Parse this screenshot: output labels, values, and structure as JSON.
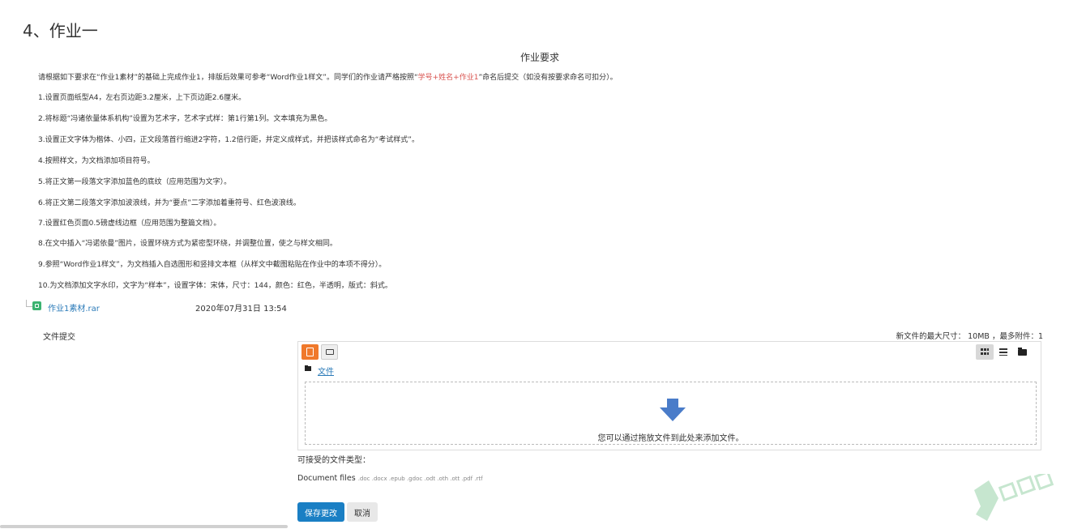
{
  "page": {
    "title": "4、作业一",
    "requirements_heading": "作业要求"
  },
  "requirements": {
    "intro_pre": "请根据如下要求在“作业1素材”的基础上完成作业1，排版后效果可参考“Word作业1样文”。同学们的作业请严格按照“",
    "intro_highlight": "学号+姓名+作业1",
    "intro_post": "”命名后提交（如没有按要求命名可扣分）。",
    "items": [
      "1.设置页面纸型A4，左右页边距3.2厘米，上下页边距2.6厘米。",
      "2.将标题“冯诸依量体系机构”设置为艺术字，艺术字式样：第1行第1列。文本填充为黑色。",
      "3.设置正文字体为楷体、小四，正文段落首行缩进2字符，1.2倍行距，并定义成样式，并把该样式命名为“考试样式”。",
      "4.按照样文，为文档添加项目符号。",
      "5.将正文第一段落文字添加蓝色的底纹（应用范围为文字）。",
      "6.将正文第二段落文字添加波浪线，并为“要点”二字添加着重符号、红色波浪线。",
      "7.设置红色页面0.5磅虚线边框（应用范围为整篇文档）。",
      "8.在文中插入“冯诺依曼”图片，设置环绕方式为紧密型环绕，并调整位置，使之与样文相同。",
      "9.参照“Word作业1样文”，为文档插入自选图形和竖排文本框（从样文中截图粘贴在作业中的本项不得分）。",
      "10.为文档添加文字水印，文字为“样本”，设置字体：宋体，尺寸：144，颜色：红色，半透明，版式：斜式。"
    ]
  },
  "attachment": {
    "name": "作业1素材.rar",
    "date": "2020年07月31日 13:54"
  },
  "submission": {
    "label": "文件提交",
    "max_size": "新文件的最大尺寸： 10MB ，最多附件：1",
    "breadcrumb": "文件",
    "drop_hint": "您可以通过拖放文件到此处来添加文件。",
    "accepted_label": "可接受的文件类型：",
    "doc_files_label": "Document files",
    "doc_files_exts": ".doc .docx .epub .gdoc .odt .oth .ott .pdf .rtf"
  },
  "buttons": {
    "save": "保存更改",
    "cancel": "取消"
  },
  "colors": {
    "link": "#2a7ab8",
    "highlight": "#d9534f",
    "primary_button": "#1a7fc4",
    "add_file_button": "#f0792b",
    "drop_arrow": "#4a7cc9"
  },
  "icons": [
    "add-file-icon",
    "create-folder-icon",
    "grid-view-icon",
    "list-view-icon",
    "tree-view-icon",
    "folder-icon",
    "archive-file-icon",
    "download-arrow-icon"
  ]
}
